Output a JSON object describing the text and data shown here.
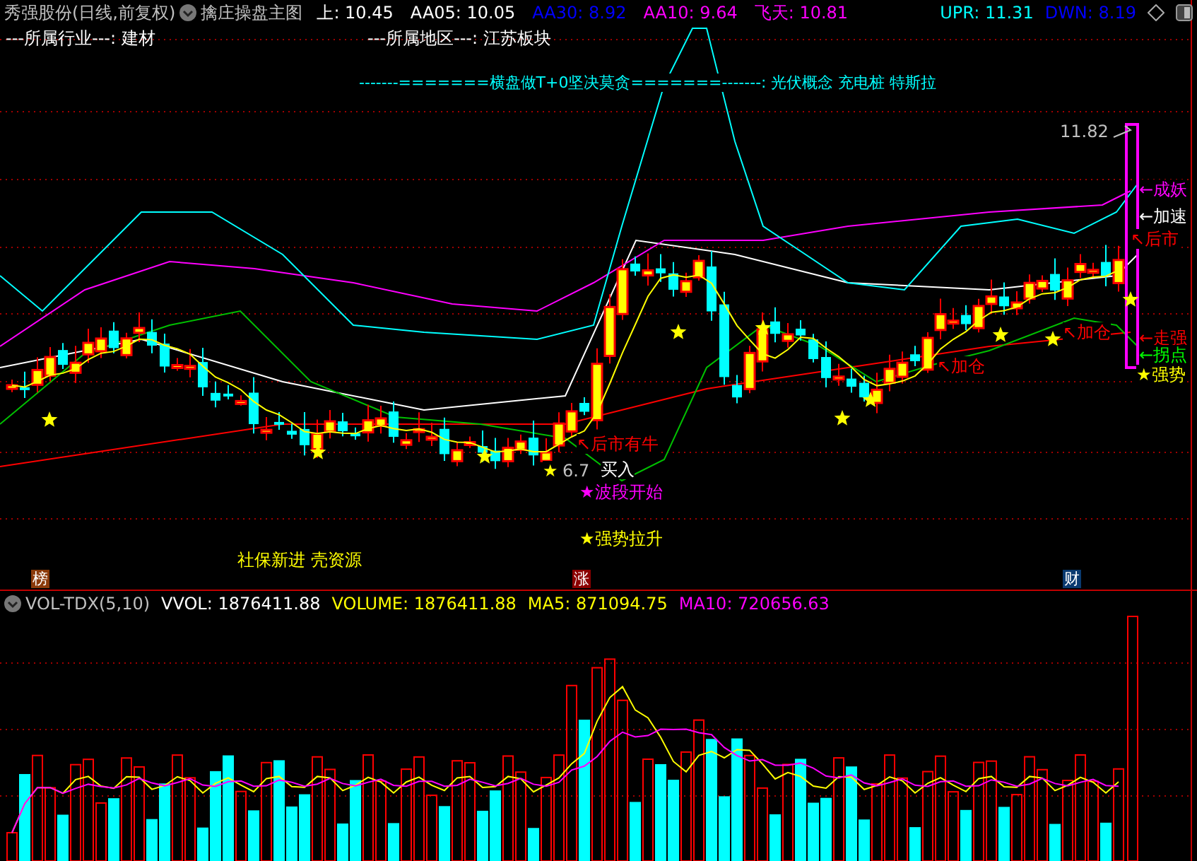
{
  "header": {
    "title": "秀强股份(日线,前复权)",
    "indicator": "擒庄操盘主图",
    "readouts": [
      {
        "text": "上: 10.45",
        "color": "#ffffff"
      },
      {
        "text": "AA05: 10.05",
        "color": "#ffffff"
      },
      {
        "text": "AA30: 8.92",
        "color": "#0000ff"
      },
      {
        "text": "AA10: 9.64",
        "color": "#ff00ff"
      },
      {
        "text": "飞天: 10.81",
        "color": "#ff00ff"
      }
    ],
    "right_readouts": [
      {
        "text": "UPR: 11.31",
        "color": "#00ffff"
      },
      {
        "text": "DWN: 8.19",
        "color": "#0000ff"
      }
    ]
  },
  "info_lines": [
    {
      "text": "---所属行业---: 建材",
      "color": "#ffffff"
    },
    {
      "text": "---所属地区---: 江苏板块",
      "color": "#ffffff"
    },
    {
      "text": "-------=======横盘做T+0坚决莫贪=======-------: 光伏概念 充电桩 特斯拉",
      "color": "#00ffff"
    }
  ],
  "chart_labels": [
    {
      "text": "11.82",
      "color": "#c0c0c0"
    },
    {
      "text": "←成妖",
      "color": "#ff00ff"
    },
    {
      "text": "←加速",
      "color": "#ffffff"
    },
    {
      "text": "↖后市",
      "color": "#ff0000"
    },
    {
      "text": "←走强",
      "color": "#ff0000"
    },
    {
      "text": "←拐点",
      "color": "#00ff00"
    },
    {
      "text": "★强势",
      "color": "#ffff00"
    },
    {
      "text": "↖加仓",
      "color": "#ff0000"
    },
    {
      "text": "↖加仓",
      "color": "#ff0000"
    },
    {
      "text": "↖后市有牛",
      "color": "#ff0000"
    },
    {
      "text": "★",
      "color": "#ffff00"
    },
    {
      "text": "6.7",
      "color": "#c0c0c0"
    },
    {
      "text": "买入",
      "color": "#ffffff"
    },
    {
      "text": "★波段开始",
      "color": "#ff00ff"
    },
    {
      "text": "★强势拉升",
      "color": "#ffff00"
    },
    {
      "text": "社保新进 壳资源",
      "color": "#ffff00"
    }
  ],
  "date_tags": [
    {
      "text": "榜",
      "color": "#8b3a0a"
    },
    {
      "text": "涨",
      "color": "#8b0000"
    },
    {
      "text": "财",
      "color": "#0a3a70"
    }
  ],
  "volume_panel": {
    "title": "VOL-TDX(5,10)",
    "readouts": [
      {
        "text": "VVOL: 1876411.88",
        "color": "#ffffff"
      },
      {
        "text": "VOLUME: 1876411.88",
        "color": "#ffff00"
      },
      {
        "text": "MA5: 871094.75",
        "color": "#ffff00"
      },
      {
        "text": "MA10: 720656.63",
        "color": "#ff00ff"
      }
    ]
  }
}
